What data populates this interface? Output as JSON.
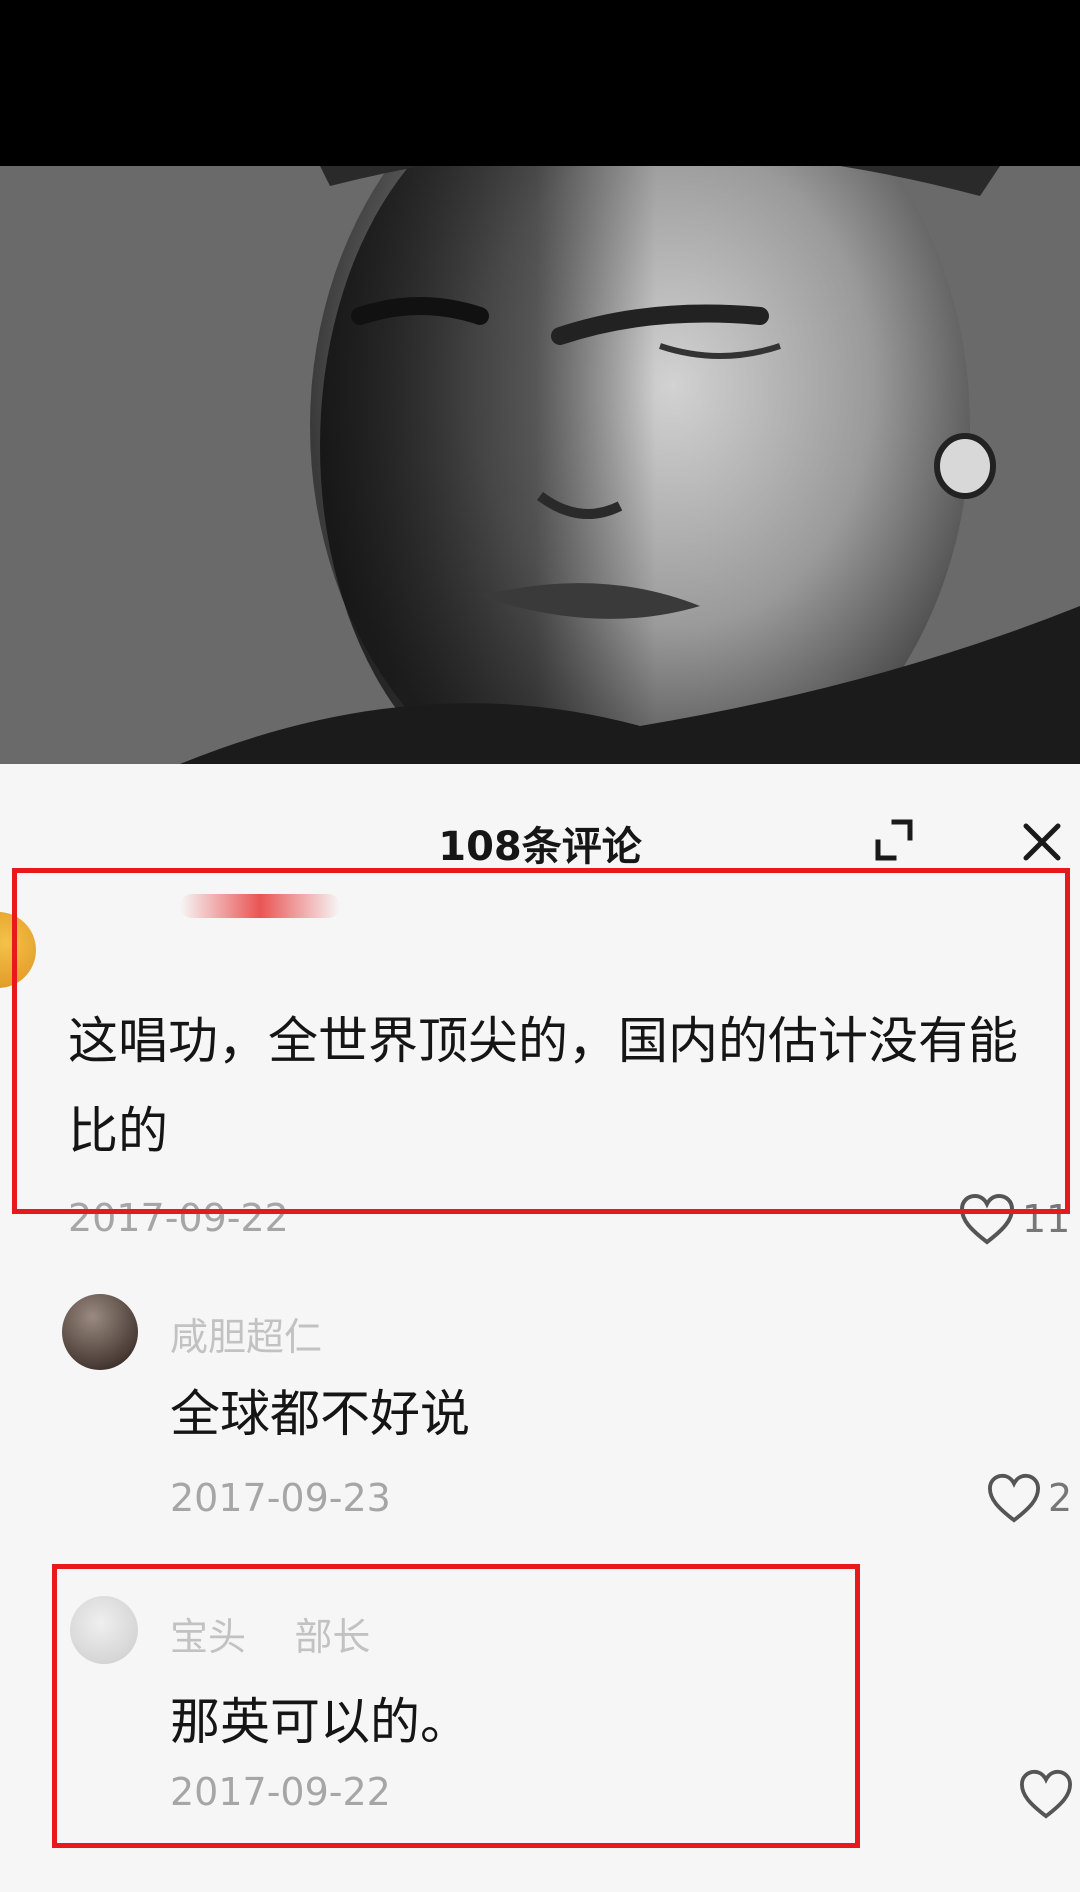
{
  "panel": {
    "title": "108条评论"
  },
  "comments": [
    {
      "username": "",
      "text": "这唱功，全世界顶尖的，国内的估计没有能比的",
      "date": "2017-09-22",
      "likes": "11",
      "is_reply": false,
      "highlighted": true
    },
    {
      "username": "咸胆超仁",
      "text": "全球都不好说",
      "date": "2017-09-23",
      "likes": "2",
      "is_reply": true,
      "highlighted": false
    },
    {
      "username": "宝头    部长",
      "text": "那英可以的。",
      "date": "2017-09-22",
      "likes": "",
      "is_reply": true,
      "highlighted": true
    }
  ],
  "colors": {
    "highlight": "#e61a1a",
    "panel_bg": "#f6f6f6",
    "text": "#151515",
    "muted": "#a6a6a6"
  },
  "icons": {
    "expand": "expand-icon",
    "close": "close-icon",
    "like": "heart-outline-icon"
  }
}
